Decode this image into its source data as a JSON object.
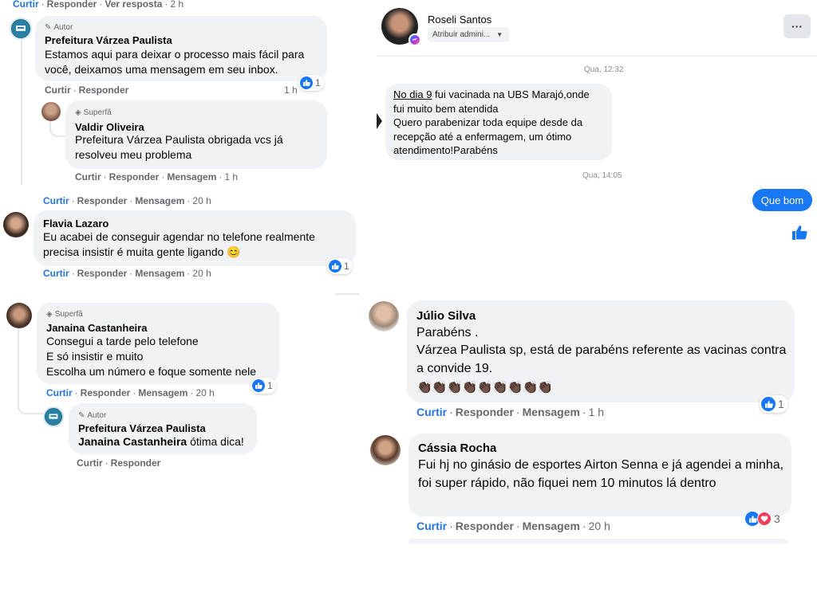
{
  "left": {
    "top_actions": {
      "like": "Curtir",
      "reply": "Responder",
      "see_reply": "Ver resposta",
      "time": "2 h"
    },
    "c1": {
      "badge": "Autor",
      "name": "Prefeitura Várzea Paulista",
      "text": "Estamos aqui para deixar o processo mais fácil para você, deixamos uma mensagem em seu inbox.",
      "like": "Curtir",
      "reply": "Responder",
      "time": "1 h",
      "reactions": "1"
    },
    "c2": {
      "badge": "Superfã",
      "name": "Valdir Oliveira",
      "text": "Prefeitura Várzea Paulista obrigada vcs já resolveu meu problema",
      "like": "Curtir",
      "reply": "Responder",
      "message": "Mensagem",
      "time": "1 h"
    },
    "c2_parent_actions": {
      "like": "Curtir",
      "reply": "Responder",
      "message": "Mensagem",
      "time": "20 h"
    },
    "c3": {
      "name": "Flavia Lazaro",
      "text": "Eu acabei de conseguir agendar no telefone realmente precisa insistir é muita gente ligando 😊",
      "like": "Curtir",
      "reply": "Responder",
      "message": "Mensagem",
      "time": "20 h",
      "reactions": "1"
    },
    "c4": {
      "badge": "Superfã",
      "name": "Janaina Castanheira",
      "line1": "Consegui a tarde pelo telefone",
      "line2": "E só insistir e muito",
      "line3": "Escolha um número e foque somente nele",
      "like": "Curtir",
      "reply": "Responder",
      "message": "Mensagem",
      "time": "20 h",
      "reactions": "1"
    },
    "c5": {
      "badge": "Autor",
      "name": "Prefeitura Várzea Paulista",
      "mention": "Janaina Castanheira",
      "text": "ótima dica!",
      "like": "Curtir",
      "reply": "Responder"
    }
  },
  "chat": {
    "contact_name": "Roseli Santos",
    "assign_label": "Atribuir admini...",
    "more_label": "···",
    "time1": "Qua, 12:32",
    "msg_underline": "No dia 9",
    "msg_rest": " fui vacinada na UBS Marajó,onde fui muito bem atendida",
    "msg_line2": "Quero parabenizar toda equipe desde da recepção até a enfermagem, um ótimo atendimento!Parabéns",
    "time2": "Qua, 14:05",
    "reply": "Que bom"
  },
  "right": {
    "r1": {
      "name": "Júlio Silva",
      "line1": "Parabéns .",
      "line2": "Várzea Paulista sp, está de parabéns referente as vacinas contra a convide 19.",
      "emojis": "👏🏿👏🏿👏🏿👏🏿👏🏿👏🏿👏🏿👏🏿👏🏿",
      "like": "Curtir",
      "reply": "Responder",
      "message": "Mensagem",
      "time": "1 h",
      "reactions": "1"
    },
    "r2": {
      "name": "Cássia Rocha",
      "text": "Fui hj no ginásio de esportes Airton Senna e já agendei a minha, foi super rápido, não fiquei nem 10 minutos lá dentro",
      "like": "Curtir",
      "reply": "Responder",
      "message": "Mensagem",
      "time": "20 h",
      "reactions": "3"
    }
  },
  "colors": {
    "messenger_blue": "#1877f2",
    "bubble_gray": "#f0f2f5",
    "link_blue": "#2374e1"
  }
}
